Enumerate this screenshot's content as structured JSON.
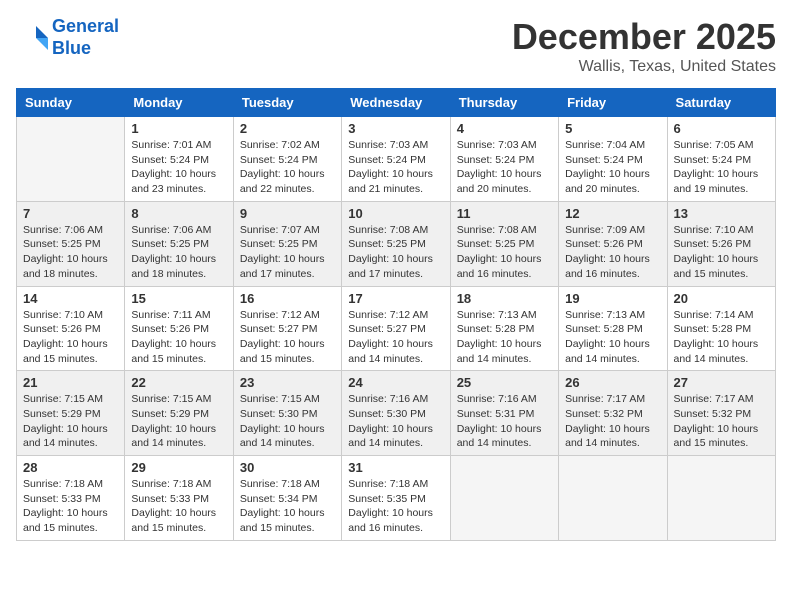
{
  "logo": {
    "line1": "General",
    "line2": "Blue"
  },
  "title": "December 2025",
  "location": "Wallis, Texas, United States",
  "days_of_week": [
    "Sunday",
    "Monday",
    "Tuesday",
    "Wednesday",
    "Thursday",
    "Friday",
    "Saturday"
  ],
  "weeks": [
    [
      {
        "day": "",
        "sunrise": "",
        "sunset": "",
        "daylight": ""
      },
      {
        "day": "1",
        "sunrise": "Sunrise: 7:01 AM",
        "sunset": "Sunset: 5:24 PM",
        "daylight": "Daylight: 10 hours and 23 minutes."
      },
      {
        "day": "2",
        "sunrise": "Sunrise: 7:02 AM",
        "sunset": "Sunset: 5:24 PM",
        "daylight": "Daylight: 10 hours and 22 minutes."
      },
      {
        "day": "3",
        "sunrise": "Sunrise: 7:03 AM",
        "sunset": "Sunset: 5:24 PM",
        "daylight": "Daylight: 10 hours and 21 minutes."
      },
      {
        "day": "4",
        "sunrise": "Sunrise: 7:03 AM",
        "sunset": "Sunset: 5:24 PM",
        "daylight": "Daylight: 10 hours and 20 minutes."
      },
      {
        "day": "5",
        "sunrise": "Sunrise: 7:04 AM",
        "sunset": "Sunset: 5:24 PM",
        "daylight": "Daylight: 10 hours and 20 minutes."
      },
      {
        "day": "6",
        "sunrise": "Sunrise: 7:05 AM",
        "sunset": "Sunset: 5:24 PM",
        "daylight": "Daylight: 10 hours and 19 minutes."
      }
    ],
    [
      {
        "day": "7",
        "sunrise": "Sunrise: 7:06 AM",
        "sunset": "Sunset: 5:25 PM",
        "daylight": "Daylight: 10 hours and 18 minutes."
      },
      {
        "day": "8",
        "sunrise": "Sunrise: 7:06 AM",
        "sunset": "Sunset: 5:25 PM",
        "daylight": "Daylight: 10 hours and 18 minutes."
      },
      {
        "day": "9",
        "sunrise": "Sunrise: 7:07 AM",
        "sunset": "Sunset: 5:25 PM",
        "daylight": "Daylight: 10 hours and 17 minutes."
      },
      {
        "day": "10",
        "sunrise": "Sunrise: 7:08 AM",
        "sunset": "Sunset: 5:25 PM",
        "daylight": "Daylight: 10 hours and 17 minutes."
      },
      {
        "day": "11",
        "sunrise": "Sunrise: 7:08 AM",
        "sunset": "Sunset: 5:25 PM",
        "daylight": "Daylight: 10 hours and 16 minutes."
      },
      {
        "day": "12",
        "sunrise": "Sunrise: 7:09 AM",
        "sunset": "Sunset: 5:26 PM",
        "daylight": "Daylight: 10 hours and 16 minutes."
      },
      {
        "day": "13",
        "sunrise": "Sunrise: 7:10 AM",
        "sunset": "Sunset: 5:26 PM",
        "daylight": "Daylight: 10 hours and 15 minutes."
      }
    ],
    [
      {
        "day": "14",
        "sunrise": "Sunrise: 7:10 AM",
        "sunset": "Sunset: 5:26 PM",
        "daylight": "Daylight: 10 hours and 15 minutes."
      },
      {
        "day": "15",
        "sunrise": "Sunrise: 7:11 AM",
        "sunset": "Sunset: 5:26 PM",
        "daylight": "Daylight: 10 hours and 15 minutes."
      },
      {
        "day": "16",
        "sunrise": "Sunrise: 7:12 AM",
        "sunset": "Sunset: 5:27 PM",
        "daylight": "Daylight: 10 hours and 15 minutes."
      },
      {
        "day": "17",
        "sunrise": "Sunrise: 7:12 AM",
        "sunset": "Sunset: 5:27 PM",
        "daylight": "Daylight: 10 hours and 14 minutes."
      },
      {
        "day": "18",
        "sunrise": "Sunrise: 7:13 AM",
        "sunset": "Sunset: 5:28 PM",
        "daylight": "Daylight: 10 hours and 14 minutes."
      },
      {
        "day": "19",
        "sunrise": "Sunrise: 7:13 AM",
        "sunset": "Sunset: 5:28 PM",
        "daylight": "Daylight: 10 hours and 14 minutes."
      },
      {
        "day": "20",
        "sunrise": "Sunrise: 7:14 AM",
        "sunset": "Sunset: 5:28 PM",
        "daylight": "Daylight: 10 hours and 14 minutes."
      }
    ],
    [
      {
        "day": "21",
        "sunrise": "Sunrise: 7:15 AM",
        "sunset": "Sunset: 5:29 PM",
        "daylight": "Daylight: 10 hours and 14 minutes."
      },
      {
        "day": "22",
        "sunrise": "Sunrise: 7:15 AM",
        "sunset": "Sunset: 5:29 PM",
        "daylight": "Daylight: 10 hours and 14 minutes."
      },
      {
        "day": "23",
        "sunrise": "Sunrise: 7:15 AM",
        "sunset": "Sunset: 5:30 PM",
        "daylight": "Daylight: 10 hours and 14 minutes."
      },
      {
        "day": "24",
        "sunrise": "Sunrise: 7:16 AM",
        "sunset": "Sunset: 5:30 PM",
        "daylight": "Daylight: 10 hours and 14 minutes."
      },
      {
        "day": "25",
        "sunrise": "Sunrise: 7:16 AM",
        "sunset": "Sunset: 5:31 PM",
        "daylight": "Daylight: 10 hours and 14 minutes."
      },
      {
        "day": "26",
        "sunrise": "Sunrise: 7:17 AM",
        "sunset": "Sunset: 5:32 PM",
        "daylight": "Daylight: 10 hours and 14 minutes."
      },
      {
        "day": "27",
        "sunrise": "Sunrise: 7:17 AM",
        "sunset": "Sunset: 5:32 PM",
        "daylight": "Daylight: 10 hours and 15 minutes."
      }
    ],
    [
      {
        "day": "28",
        "sunrise": "Sunrise: 7:18 AM",
        "sunset": "Sunset: 5:33 PM",
        "daylight": "Daylight: 10 hours and 15 minutes."
      },
      {
        "day": "29",
        "sunrise": "Sunrise: 7:18 AM",
        "sunset": "Sunset: 5:33 PM",
        "daylight": "Daylight: 10 hours and 15 minutes."
      },
      {
        "day": "30",
        "sunrise": "Sunrise: 7:18 AM",
        "sunset": "Sunset: 5:34 PM",
        "daylight": "Daylight: 10 hours and 15 minutes."
      },
      {
        "day": "31",
        "sunrise": "Sunrise: 7:18 AM",
        "sunset": "Sunset: 5:35 PM",
        "daylight": "Daylight: 10 hours and 16 minutes."
      },
      {
        "day": "",
        "sunrise": "",
        "sunset": "",
        "daylight": ""
      },
      {
        "day": "",
        "sunrise": "",
        "sunset": "",
        "daylight": ""
      },
      {
        "day": "",
        "sunrise": "",
        "sunset": "",
        "daylight": ""
      }
    ]
  ]
}
